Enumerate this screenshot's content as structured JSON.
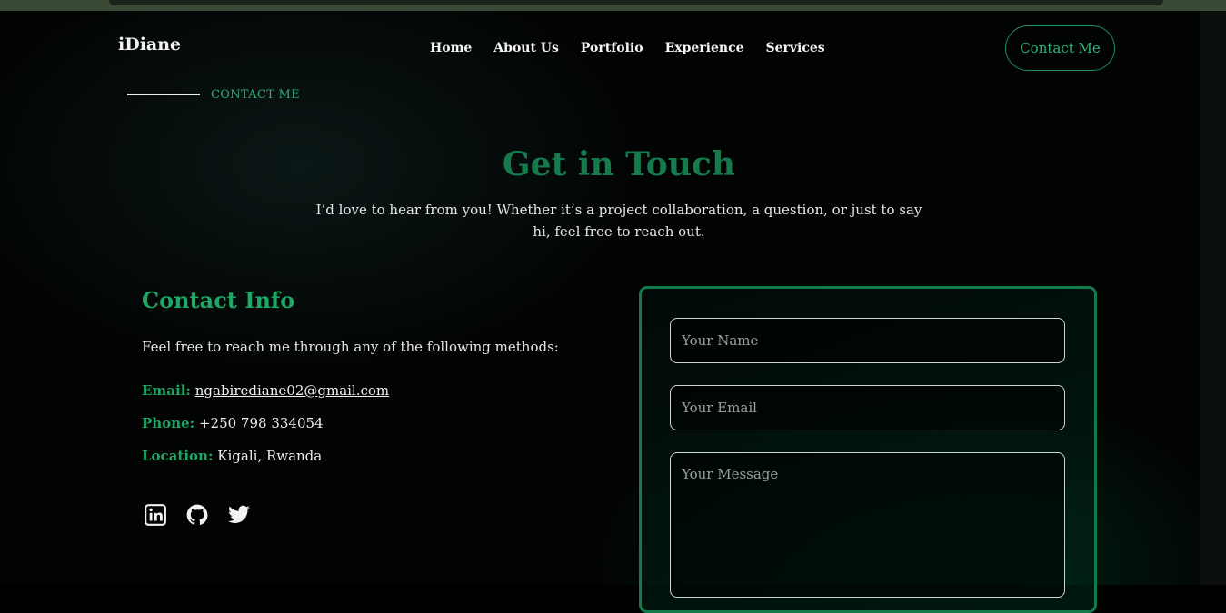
{
  "header": {
    "logo": "iDiane",
    "nav": [
      "Home",
      "About Us",
      "Portfolio",
      "Experience",
      "Services"
    ],
    "cta": "Contact Me"
  },
  "section": {
    "eyebrow": "CONTACT ME",
    "title": "Get in Touch",
    "intro": "I’d love to hear from you! Whether it’s a project collaboration, a question, or just to say hi, feel free to reach out."
  },
  "contact_info": {
    "title": "Contact Info",
    "description": "Feel free to reach me through any of the following methods:",
    "email_label": "Email:",
    "email": "ngabirediane02@gmail.com",
    "phone_label": "Phone:",
    "phone": "+250 798 334054",
    "location_label": "Location:",
    "location": "Kigali, Rwanda",
    "socials": [
      "linkedin-icon",
      "github-icon",
      "twitter-icon"
    ]
  },
  "form": {
    "name_placeholder": "Your Name",
    "email_placeholder": "Your Email",
    "message_placeholder": "Your Message"
  },
  "colors": {
    "accent": "#1ea865",
    "heading": "#157a4c",
    "background": "#020303"
  }
}
